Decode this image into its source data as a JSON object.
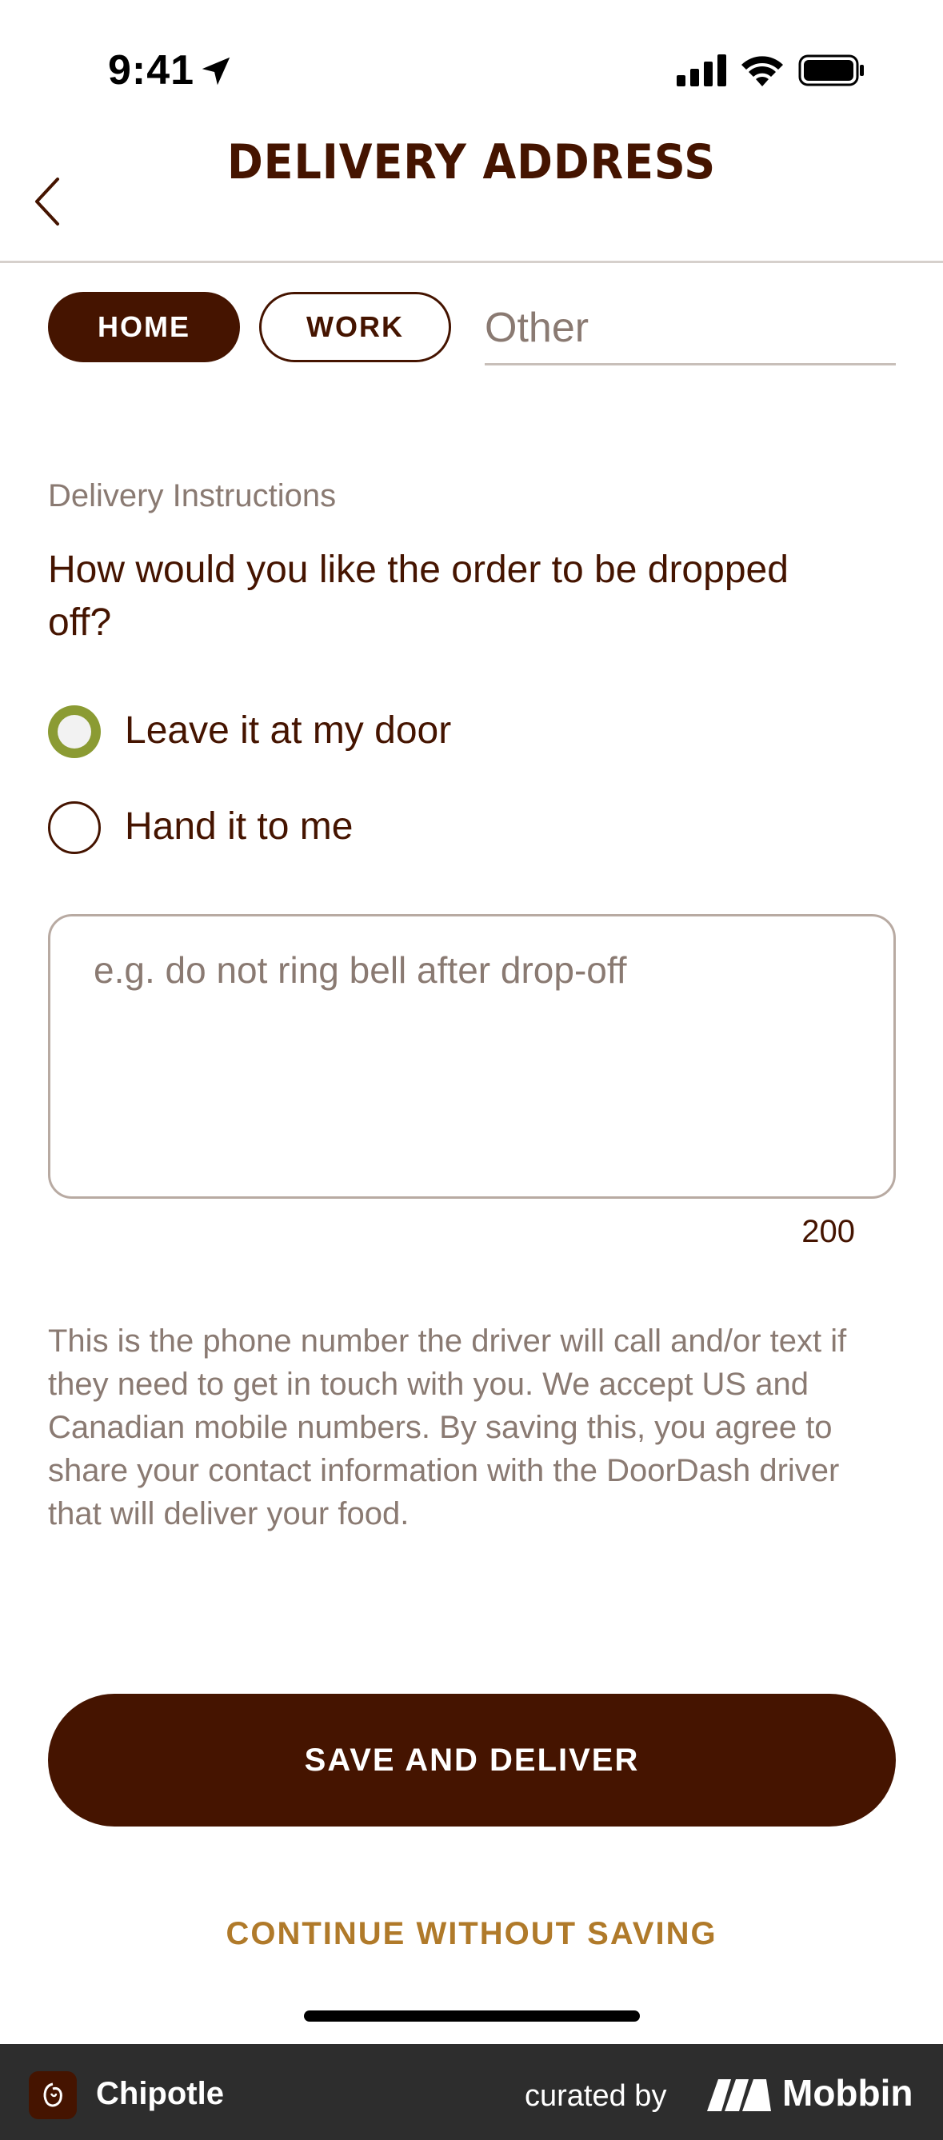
{
  "status_bar": {
    "time": "9:41"
  },
  "header": {
    "title": "DELIVERY ADDRESS"
  },
  "address_type": {
    "options": [
      "HOME",
      "WORK"
    ],
    "selected": "HOME",
    "other_placeholder": "Other"
  },
  "instructions": {
    "section_label": "Delivery Instructions",
    "question": "How would you like the order to be dropped off?",
    "options": [
      {
        "label": "Leave it at my door",
        "selected": true
      },
      {
        "label": "Hand it to me",
        "selected": false
      }
    ],
    "textarea_placeholder": "e.g. do not ring bell after drop-off",
    "char_count": "200"
  },
  "info_text": "This is the phone number the driver will call and/or text if they need to get in touch with you. We accept US and Canadian mobile numbers. By saving this, you agree to share your contact information with the DoorDash driver that will deliver your food.",
  "actions": {
    "save_label": "SAVE AND DELIVER",
    "continue_label": "CONTINUE WITHOUT SAVING"
  },
  "footer": {
    "app_name": "Chipotle",
    "curated_by": "curated by",
    "brand": "Mobbin"
  },
  "colors": {
    "primary": "#451400",
    "accent": "#b07a2a",
    "radio_selected": "#8b9b33",
    "muted": "#8a7a72"
  }
}
